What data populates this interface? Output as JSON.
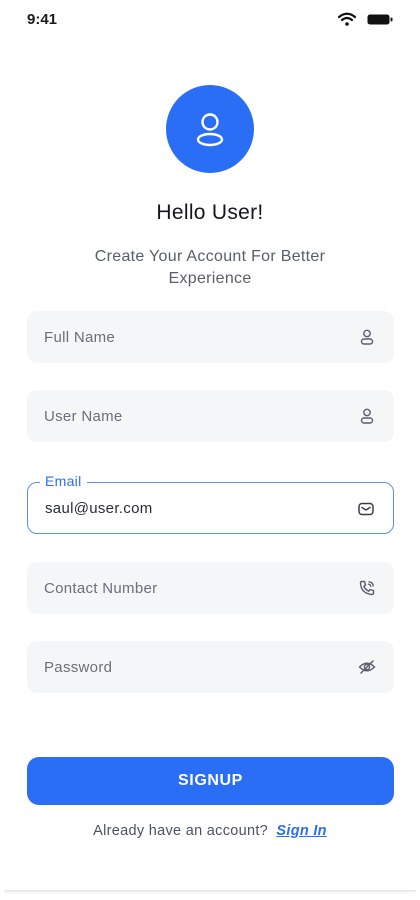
{
  "status_bar": {
    "time": "9:41",
    "wifi_icon": "wifi-icon",
    "battery_icon": "battery-icon"
  },
  "header": {
    "avatar_icon": "user-icon",
    "greeting": "Hello User!",
    "subtitle": "Create Your Account For Better Experience"
  },
  "form": {
    "full_name": {
      "placeholder": "Full Name",
      "value": "",
      "icon": "user-icon"
    },
    "user_name": {
      "placeholder": "User Name",
      "value": "",
      "icon": "user-icon"
    },
    "email": {
      "label": "Email",
      "value": "saul@user.com",
      "icon": "mail-icon"
    },
    "contact_number": {
      "placeholder": "Contact Number",
      "value": "",
      "icon": "phone-icon"
    },
    "password": {
      "placeholder": "Password",
      "value": "",
      "icon": "eye-off-icon"
    }
  },
  "actions": {
    "signup_label": "SIGNUP",
    "signin_prompt": "Already have an account?",
    "signin_link": "Sign In"
  },
  "colors": {
    "accent": "#2a6ef5",
    "field_bg": "#f5f6f8",
    "active_border": "#5b8ef0"
  }
}
